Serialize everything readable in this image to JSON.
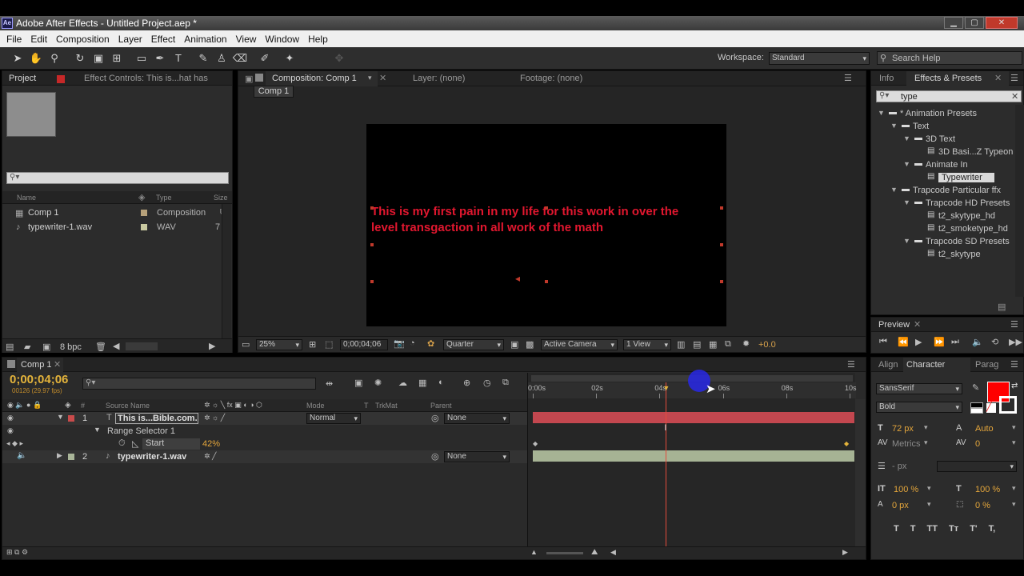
{
  "window": {
    "title": "Adobe After Effects - Untitled Project.aep *",
    "logo": "Ae",
    "btn_min": "▁",
    "btn_max": "▢",
    "btn_close": "✕"
  },
  "menu": [
    "File",
    "Edit",
    "Composition",
    "Layer",
    "Effect",
    "Animation",
    "View",
    "Window",
    "Help"
  ],
  "toolbar": {
    "workspace_label": "Workspace:",
    "workspace_value": "Standard",
    "search_help": "Search Help"
  },
  "project": {
    "tab": "Project",
    "effect_controls_tab": "Effect Controls: This is...hat has",
    "columns": {
      "name": "Name",
      "type": "Type",
      "size": "Size"
    },
    "items": [
      {
        "name": "Comp 1",
        "type": "Composition",
        "size": ""
      },
      {
        "name": "typewriter-1.wav",
        "type": "WAV",
        "size": "7"
      }
    ],
    "bpc": "8 bpc"
  },
  "viewer": {
    "comp_tab": "Composition: Comp 1",
    "layer_tab": "Layer: (none)",
    "footage_tab": "Footage: (none)",
    "breadcrumb": "Comp 1",
    "text_line1": "This is my first pain in my life for this work in over the",
    "text_line2": "level transgaction in all work of the math",
    "zoom": "25%",
    "timecode": "0;00;04;06",
    "resolution": "Quarter",
    "camera": "Active Camera",
    "views": "1 View",
    "exposure": "+0.0"
  },
  "effects": {
    "info_tab": "Info",
    "tab": "Effects & Presets",
    "search": "type",
    "tree": [
      {
        "label": "* Animation Presets",
        "level": 0,
        "kind": "folder-open"
      },
      {
        "label": "Text",
        "level": 1,
        "kind": "folder-open"
      },
      {
        "label": "3D Text",
        "level": 2,
        "kind": "folder-open"
      },
      {
        "label": "3D Basi...Z Typeon",
        "level": 3,
        "kind": "preset"
      },
      {
        "label": "Animate In",
        "level": 2,
        "kind": "folder-open"
      },
      {
        "label": "Typewriter",
        "level": 3,
        "kind": "preset",
        "selected": true
      },
      {
        "label": "Trapcode Particular ffx",
        "level": 1,
        "kind": "folder-open"
      },
      {
        "label": "Trapcode HD Presets",
        "level": 2,
        "kind": "folder-open"
      },
      {
        "label": "t2_skytype_hd",
        "level": 3,
        "kind": "preset"
      },
      {
        "label": "t2_smoketype_hd",
        "level": 3,
        "kind": "preset"
      },
      {
        "label": "Trapcode SD Presets",
        "level": 2,
        "kind": "folder-open"
      },
      {
        "label": "t2_skytype",
        "level": 3,
        "kind": "preset"
      }
    ]
  },
  "preview": {
    "tab": "Preview"
  },
  "character": {
    "align_tab": "Align",
    "tab": "Character",
    "para_tab": "Parag",
    "font": "SansSerif",
    "style": "Bold",
    "size": "72 px",
    "leading": "Auto",
    "kerning": "Metrics",
    "tracking": "0",
    "stroke": "- px",
    "vscale": "100 %",
    "hscale": "100 %",
    "baseline": "0 px",
    "tsume": "0 %",
    "color_fill": "#ff0000"
  },
  "timeline": {
    "tab": "Comp 1",
    "timecode": "0;00;04;06",
    "fps": "00126 (29.97 fps)",
    "col_source": "Source Name",
    "col_mode": "Mode",
    "col_t": "T",
    "col_trkmat": "TrkMat",
    "col_parent": "Parent",
    "col_num": "#",
    "layers": [
      {
        "num": "1",
        "name": "This is...Bible.com.",
        "mode": "Normal",
        "parent": "None"
      },
      {
        "num": "2",
        "name": "typewriter-1.wav",
        "mode": "",
        "parent": "None"
      }
    ],
    "range_selector": "Range Selector 1",
    "start_label": "Start",
    "start_value": "42%",
    "ruler": [
      "0:00s",
      "02s",
      "04s",
      "06s",
      "08s",
      "10s"
    ],
    "playhead_fraction": 0.42
  }
}
